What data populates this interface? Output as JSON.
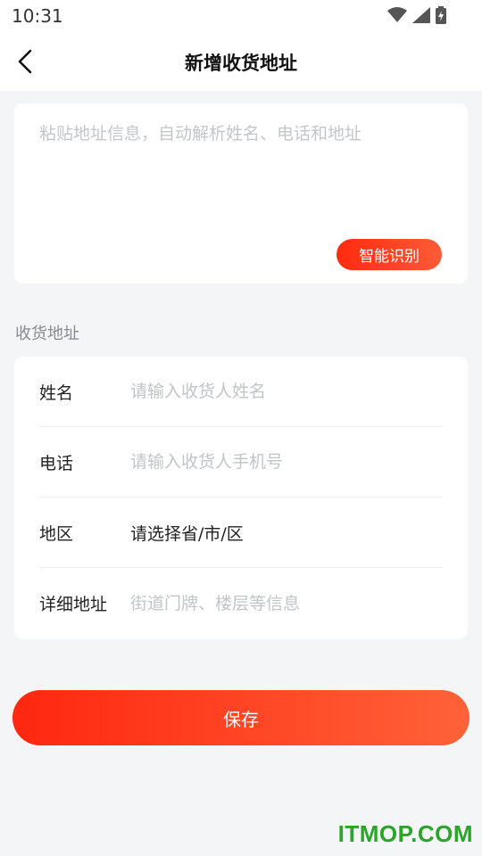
{
  "status_bar": {
    "time": "10:31",
    "icons": [
      "wifi-icon",
      "signal-icon",
      "battery-charging-icon"
    ]
  },
  "header": {
    "title": "新增收货地址",
    "back_icon": "chevron-left-icon"
  },
  "paste_box": {
    "placeholder": "粘贴地址信息，自动解析姓名、电话和地址",
    "value": "",
    "smart_button_label": "智能识别"
  },
  "section_title": "收货地址",
  "form": {
    "name": {
      "label": "姓名",
      "placeholder": "请输入收货人姓名"
    },
    "phone": {
      "label": "电话",
      "placeholder": "请输入收货人手机号"
    },
    "region": {
      "label": "地区",
      "value": "请选择省/市/区"
    },
    "detail": {
      "label": "详细地址",
      "placeholder": "街道门牌、楼层等信息"
    }
  },
  "save_button_label": "保存",
  "watermark": "ITMOP.COM",
  "colors": {
    "accent_start": "#ff2710",
    "accent_end": "#ff6238",
    "background": "#f4f5f7",
    "watermark": "#2aa52a"
  }
}
